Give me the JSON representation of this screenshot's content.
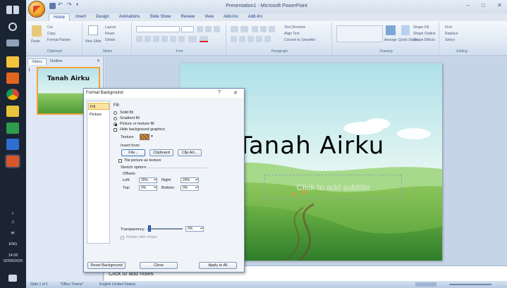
{
  "window": {
    "title": "Presentation1 - Microsoft PowerPoint",
    "controls": [
      "–",
      "□",
      "✕"
    ]
  },
  "ribbon": {
    "tabs": [
      "Home",
      "Insert",
      "Design",
      "Animations",
      "Slide Show",
      "Review",
      "View",
      "Add-Ins",
      "Add-Ins"
    ],
    "active_tab": 0,
    "groups": {
      "clipboard": {
        "label": "Clipboard",
        "paste": "Paste",
        "cut": "Cut",
        "copy": "Copy",
        "format_painter": "Format Painter"
      },
      "slides": {
        "label": "Slides",
        "new_slide": "New Slide",
        "layout": "Layout",
        "reset": "Reset",
        "delete": "Delete"
      },
      "font": {
        "label": "Font"
      },
      "paragraph": {
        "label": "Paragraph",
        "text_direction": "Text Direction",
        "align_text": "Align Text",
        "convert_smartart": "Convert to SmartArt"
      },
      "drawing": {
        "label": "Drawing",
        "arrange": "Arrange",
        "quick_styles": "Quick Styles",
        "shape_fill": "Shape Fill",
        "shape_outline": "Shape Outline",
        "shape_effects": "Shape Effects"
      },
      "editing": {
        "label": "Editing",
        "find": "Find",
        "replace": "Replace",
        "select": "Select"
      }
    }
  },
  "slides_pane": {
    "tabs": [
      "Slides",
      "Outline"
    ],
    "close_icon": "✕",
    "thumb_number": "1",
    "thumb_title": "Tanah Airku"
  },
  "slide": {
    "title": "Tanah Airku",
    "subtitle_placeholder": "Click to add subtitle"
  },
  "notes": {
    "placeholder": "Click to add notes"
  },
  "status": {
    "slide_of": "Slide 1 of 1",
    "theme": "\"Office Theme\"",
    "language": "English (United States)"
  },
  "taskbar": {
    "time": "14:06",
    "date": "02/05/2020",
    "lang": "ENG"
  },
  "dialog": {
    "title": "Format Background",
    "help": "?",
    "close": "✕",
    "nav": [
      "Fill",
      "Picture"
    ],
    "active_nav": 0,
    "fill_header": "Fill",
    "options": {
      "solid_fill": "Solid fill",
      "gradient_fill": "Gradient fill",
      "picture_fill": "Picture or texture fill",
      "hide_graphics": "Hide background graphics"
    },
    "texture_label": "Texture:",
    "insert_from": "Insert from:",
    "buttons": {
      "file": "File...",
      "clipboard": "Clipboard",
      "clipart": "Clip Art...",
      "reset": "Reset Background",
      "close": "Close",
      "apply_all": "Apply to All"
    },
    "tile_label": "Tile picture as texture",
    "stretch_options": "Stretch options",
    "offsets": "Offsets:",
    "left_label": "Left:",
    "left_value": "20%",
    "right_label": "Right:",
    "right_value": "20%",
    "top_label": "Top:",
    "top_value": "0%",
    "bottom_label": "Bottom:",
    "bottom_value": "0%",
    "transparency_label": "Transparency:",
    "transparency_value": "0%",
    "rotate_label": "Rotate with shape"
  },
  "colors": {
    "ribbon_bg": "#dde7f3",
    "accent": "#f0a33a",
    "taskbar": "#1b2433"
  }
}
